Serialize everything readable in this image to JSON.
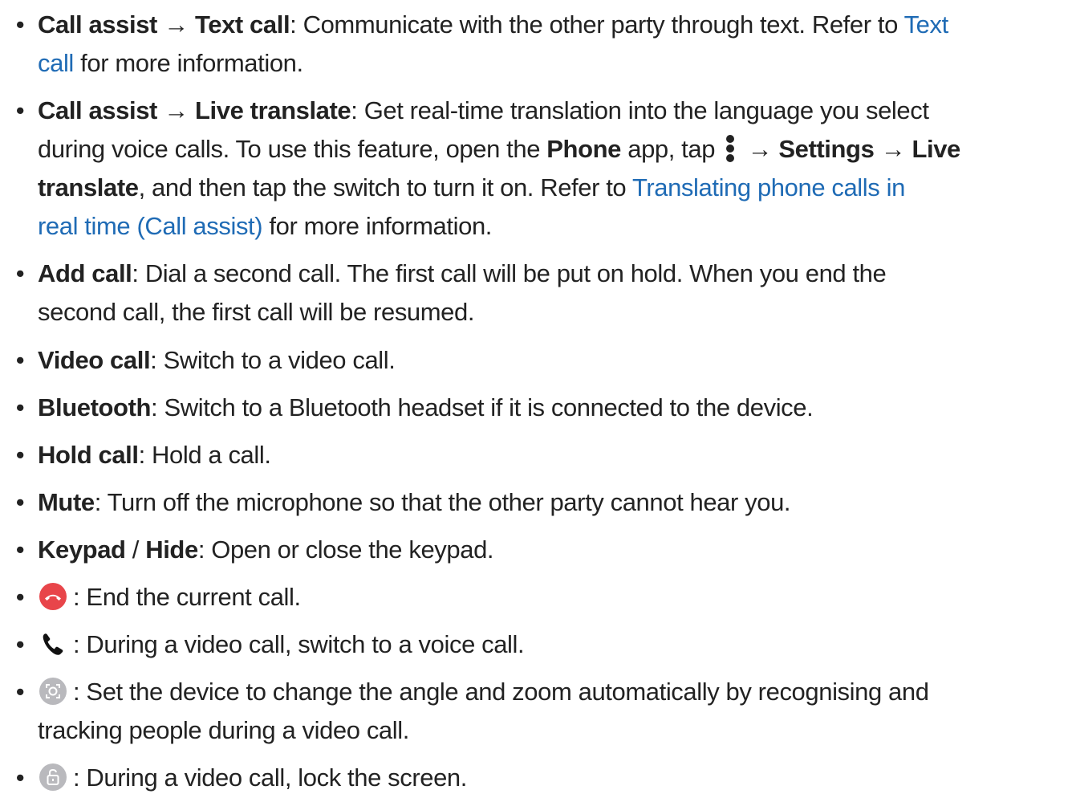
{
  "colors": {
    "text": "#222222",
    "link": "#1f6bb5",
    "end_call_red": "#e8454a",
    "icon_grey": "#b9b9bd"
  },
  "items": [
    {
      "b1": "Call assist",
      "arrow1": " → ",
      "b2": "Text call",
      "t1": ": Communicate with the other party through text. Refer to ",
      "link1": "Text",
      "link2": "call",
      "t2": " for more information."
    },
    {
      "b1": "Call assist",
      "arrow1": " → ",
      "b2": "Live translate",
      "t1": ": Get real-time translation into the language you select",
      "t2": "during voice calls. To use this feature, open the ",
      "b3": "Phone",
      "t3": " app, tap ",
      "icon": "more-options-icon",
      "arrow2": " → ",
      "b4": "Settings",
      "arrow3": " → ",
      "b5": "Live",
      "b6": "translate",
      "t4": ", and then tap the switch to turn it on. Refer to ",
      "link1": "Translating phone calls in",
      "link2": "real time (Call assist)",
      "t5": " for more information."
    },
    {
      "b1": "Add call",
      "t1": ": Dial a second call. The first call will be put on hold. When you end the",
      "t2": "second call, the first call will be resumed."
    },
    {
      "b1": "Video call",
      "t1": ": Switch to a video call."
    },
    {
      "b1": "Bluetooth",
      "t1": ": Switch to a Bluetooth headset if it is connected to the device."
    },
    {
      "b1": "Hold call",
      "t1": ": Hold a call."
    },
    {
      "b1": "Mute",
      "t1": ": Turn off the microphone so that the other party cannot hear you."
    },
    {
      "b1": "Keypad",
      "sep": " / ",
      "b2": "Hide",
      "t1": ": Open or close the keypad."
    },
    {
      "icon": "end-call-icon",
      "t1": ": End the current call."
    },
    {
      "icon": "phone-icon",
      "t1": ": During a video call, switch to a voice call."
    },
    {
      "icon": "auto-framing-icon",
      "t1": ": Set the device to change the angle and zoom automatically by recognising and",
      "t2": "tracking people during a video call."
    },
    {
      "icon": "lock-icon",
      "t1": ": During a video call, lock the screen."
    }
  ],
  "bullet": "•"
}
